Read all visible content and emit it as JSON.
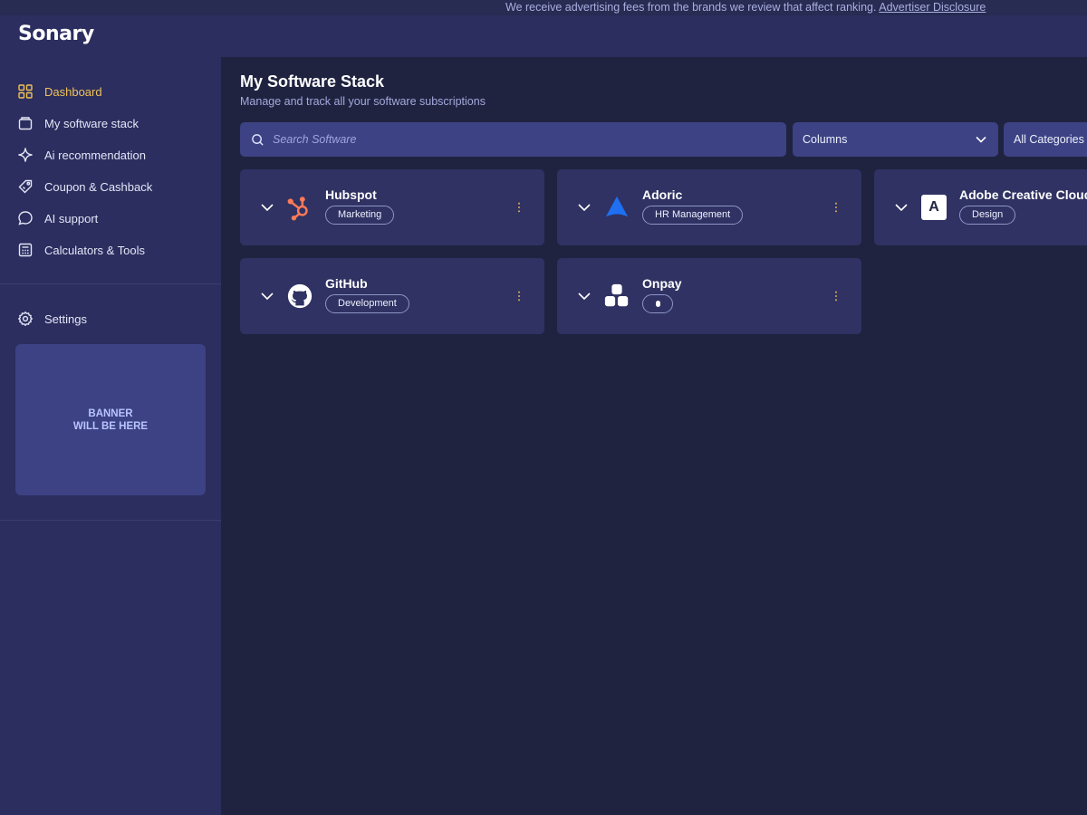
{
  "disclosure": {
    "text": "We receive advertising fees from the brands we review that affect ranking.",
    "link": "Advertiser Disclosure"
  },
  "app": {
    "logo": "Sonary"
  },
  "sidebar": {
    "items": [
      {
        "label": "Dashboard",
        "icon": "grid-icon",
        "active": true
      },
      {
        "label": "My software stack",
        "icon": "folder-icon"
      },
      {
        "label": "Ai recommendation",
        "icon": "sparkle-icon"
      },
      {
        "label": "Coupon & Cashback",
        "icon": "tag-icon"
      },
      {
        "label": "AI support",
        "icon": "chat-icon"
      },
      {
        "label": "Calculators & Tools",
        "icon": "calculator-icon"
      }
    ],
    "settings": {
      "label": "Settings",
      "icon": "gear-icon"
    },
    "banner": {
      "line1": "BANNER",
      "line2": "WILL BE HERE"
    }
  },
  "main": {
    "title": "My Software Stack",
    "subtitle": "Manage and track all your software subscriptions",
    "search": {
      "placeholder": "Search Software",
      "value": ""
    },
    "columns_select": {
      "value": "Columns"
    },
    "categories_select": {
      "value": "All Categories"
    },
    "cards": [
      {
        "name": "Hubspot",
        "tag": "Marketing",
        "logo": "hubspot-logo"
      },
      {
        "name": "Adoric",
        "tag": "HR Management",
        "logo": "adoric-logo"
      },
      {
        "name": "Adobe Creative Cloud",
        "tag": "Design",
        "logo": "adobe-logo",
        "logo_letter": "A"
      },
      {
        "name": "GitHub",
        "tag": "Development",
        "logo": "github-logo"
      },
      {
        "name": "Onpay",
        "tag": "",
        "logo": "onpay-logo"
      }
    ]
  },
  "colors": {
    "background": "#1f2340",
    "sidebar": "#2b2e5e",
    "card": "#2f3262",
    "input": "#3c4283",
    "active": "#f0c15a",
    "hubspot": "#ff7a59",
    "adoric": "#1f6ff2"
  }
}
